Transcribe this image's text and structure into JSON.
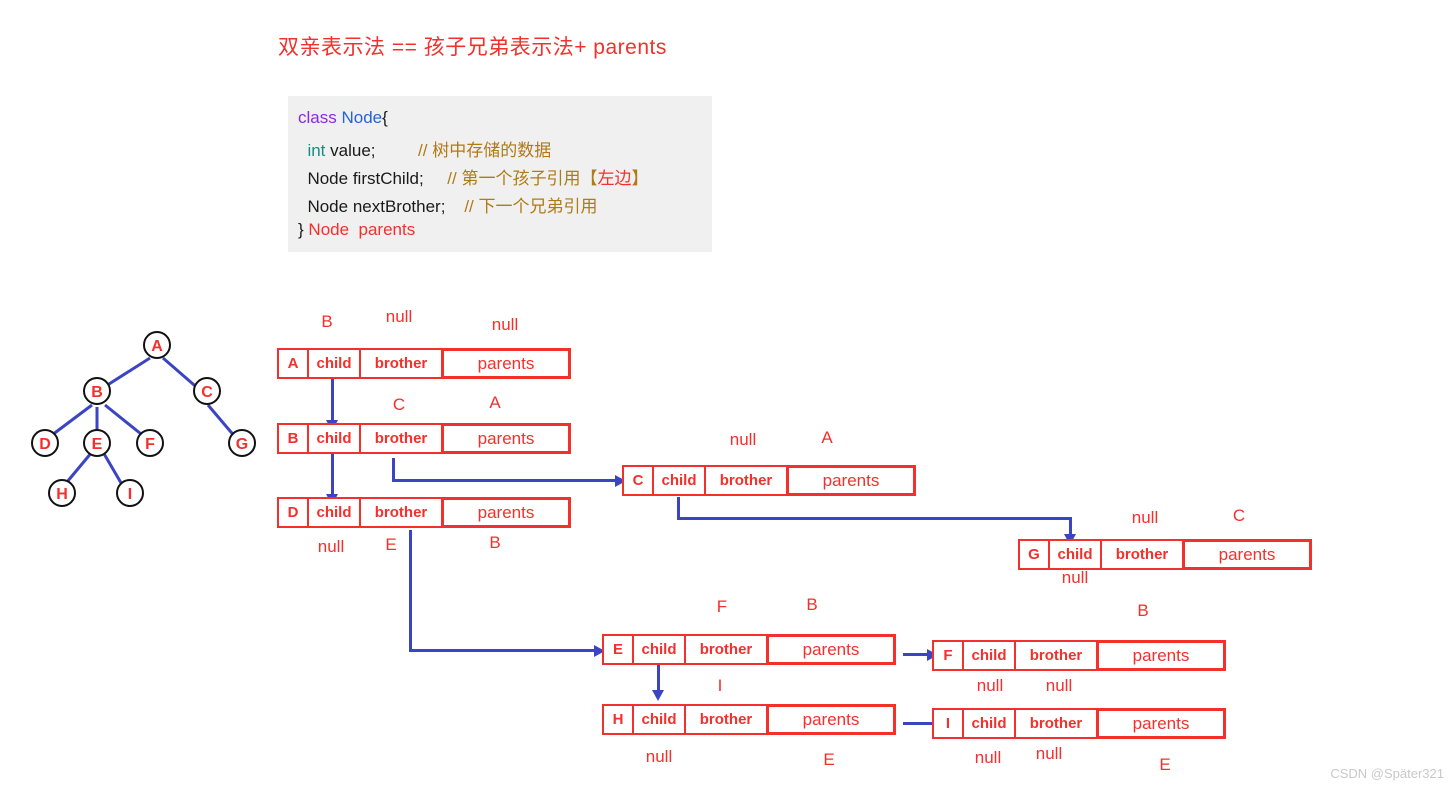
{
  "title": "双亲表示法 == 孩子兄弟表示法+ parents",
  "code": {
    "line1_kw": "class",
    "line1_type": "Node",
    "line1_brace": "{",
    "line2_type": "int",
    "line2_name": "value;",
    "line2_comment": "// 树中存储的数据",
    "line3_decl": "Node firstChild;",
    "line3_comment": "// 第一个孩子引用【",
    "line3_comment_red": "左边",
    "line3_comment_end": "】",
    "line4_decl": "Node nextBrother;",
    "line4_comment": "// 下一个兄弟引用",
    "line5_brace": "}",
    "line5_type": "Node",
    "line5_field": "parents"
  },
  "tree": {
    "nodes": [
      {
        "id": "A",
        "label": "A"
      },
      {
        "id": "B",
        "label": "B"
      },
      {
        "id": "C",
        "label": "C"
      },
      {
        "id": "D",
        "label": "D"
      },
      {
        "id": "E",
        "label": "E"
      },
      {
        "id": "F",
        "label": "F"
      },
      {
        "id": "G",
        "label": "G"
      },
      {
        "id": "H",
        "label": "H"
      },
      {
        "id": "I",
        "label": "I"
      }
    ],
    "edges": [
      [
        "A",
        "B"
      ],
      [
        "A",
        "C"
      ],
      [
        "B",
        "D"
      ],
      [
        "B",
        "E"
      ],
      [
        "B",
        "F"
      ],
      [
        "E",
        "H"
      ],
      [
        "E",
        "I"
      ],
      [
        "C",
        "G"
      ]
    ]
  },
  "field_labels": {
    "child": "child",
    "brother": "brother",
    "parents": "parents"
  },
  "records": [
    {
      "key": "A",
      "child_val": "B",
      "brother_val": "null",
      "parents_val": "null"
    },
    {
      "key": "B",
      "child_val": "D",
      "brother_val": "C",
      "parents_val": "A"
    },
    {
      "key": "D",
      "child_val": "null",
      "brother_val": "E",
      "parents_val": "B"
    },
    {
      "key": "C",
      "child_val": "G",
      "brother_val": "null",
      "parents_val": "A"
    },
    {
      "key": "G",
      "child_val": "null",
      "brother_val": "null",
      "parents_val": "C"
    },
    {
      "key": "E",
      "child_val": "H",
      "brother_val": "F",
      "parents_val": "B"
    },
    {
      "key": "F",
      "child_val": "null",
      "brother_val": "null",
      "parents_val": "B"
    },
    {
      "key": "H",
      "child_val": "null",
      "brother_val": "I",
      "parents_val": "E"
    },
    {
      "key": "I",
      "child_val": "null",
      "brother_val": "null",
      "parents_val": "E"
    }
  ],
  "visible_labels": {
    "a_child": "B",
    "a_brother": "null",
    "a_parents": "null",
    "b_brother": "C",
    "b_parents": "A",
    "d_child": "null",
    "d_brother": "E",
    "d_parents": "B",
    "c_brother": "null",
    "c_parents": "A",
    "g_brother": "null",
    "g_parents": "C",
    "g_child": "null",
    "e_brother": "F",
    "e_parents": "B",
    "f_child": "null",
    "f_brother": "null",
    "f_parents": "B",
    "h_brother": "I",
    "h_child": "null",
    "h_parents": "E",
    "i_child": "null",
    "i_brother": "null",
    "i_parents": "E"
  },
  "watermark": "CSDN @Später321"
}
